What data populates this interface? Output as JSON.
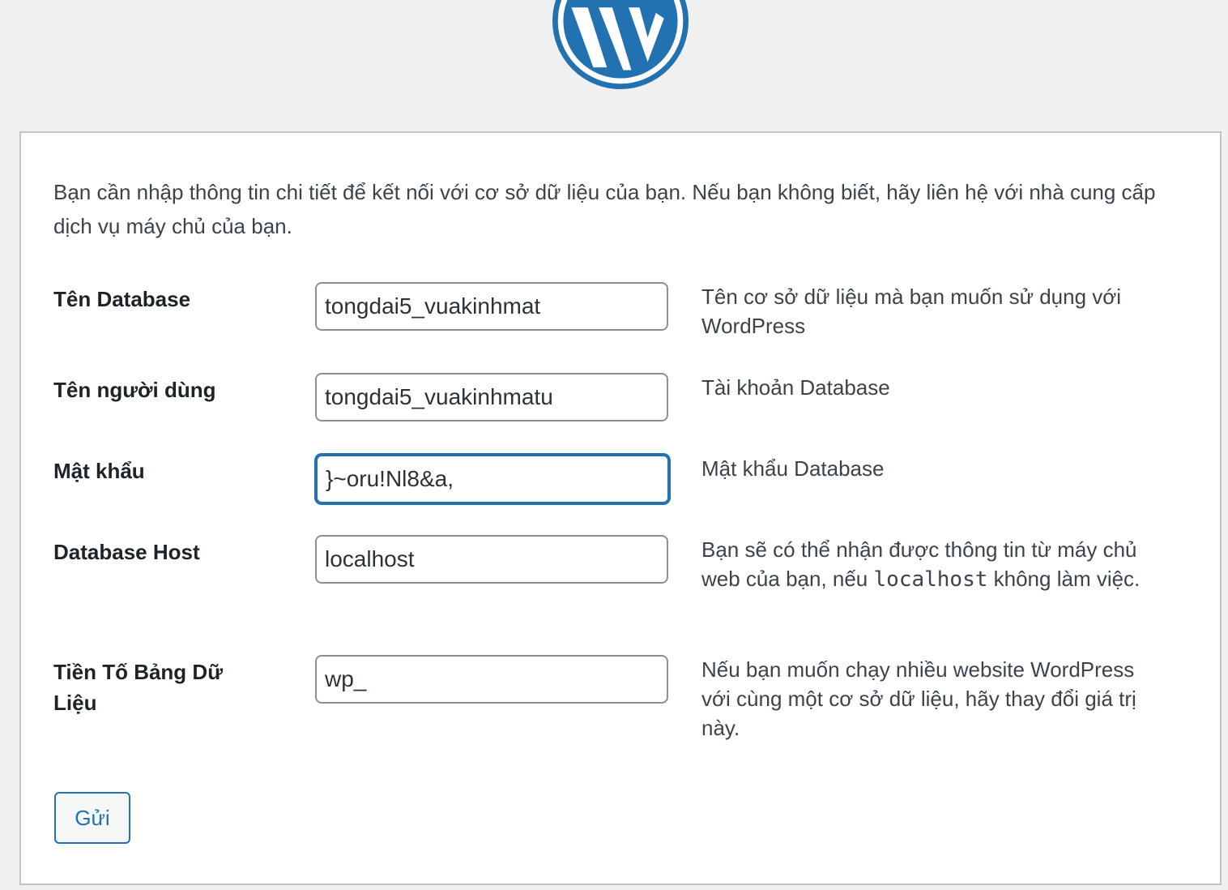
{
  "intro_text": "Bạn cần nhập thông tin chi tiết để kết nối với cơ sở dữ liệu của bạn. Nếu bạn không biết, hãy liên hệ với nhà cung cấp dịch vụ máy chủ của bạn.",
  "fields": {
    "dbname": {
      "label": "Tên Database",
      "value": "tongdai5_vuakinhmat",
      "help": "Tên cơ sở dữ liệu mà bạn muốn sử dụng với WordPress"
    },
    "username": {
      "label": "Tên người dùng",
      "value": "tongdai5_vuakinhmatu",
      "help": "Tài khoản Database"
    },
    "password": {
      "label": "Mật khẩu",
      "value": "}~oru!Nl8&a,",
      "help": "Mật khẩu Database"
    },
    "dbhost": {
      "label": "Database Host",
      "value": "localhost",
      "help_before": "Bạn sẽ có thể nhận được thông tin từ máy chủ web của bạn, nếu",
      "help_code": "localhost",
      "help_after": "không làm việc."
    },
    "prefix": {
      "label": "Tiền Tố Bảng Dữ Liệu",
      "value": "wp_",
      "help": "Nếu bạn muốn chạy nhiều website WordPress với cùng một cơ sở dữ liệu, hãy thay đổi giá trị này."
    }
  },
  "submit_label": "Gửi",
  "colors": {
    "accent": "#2271b1",
    "logo": "#2271b1",
    "background": "#f0f0f1"
  },
  "icons": {
    "logo": "wordpress-logo-icon"
  }
}
